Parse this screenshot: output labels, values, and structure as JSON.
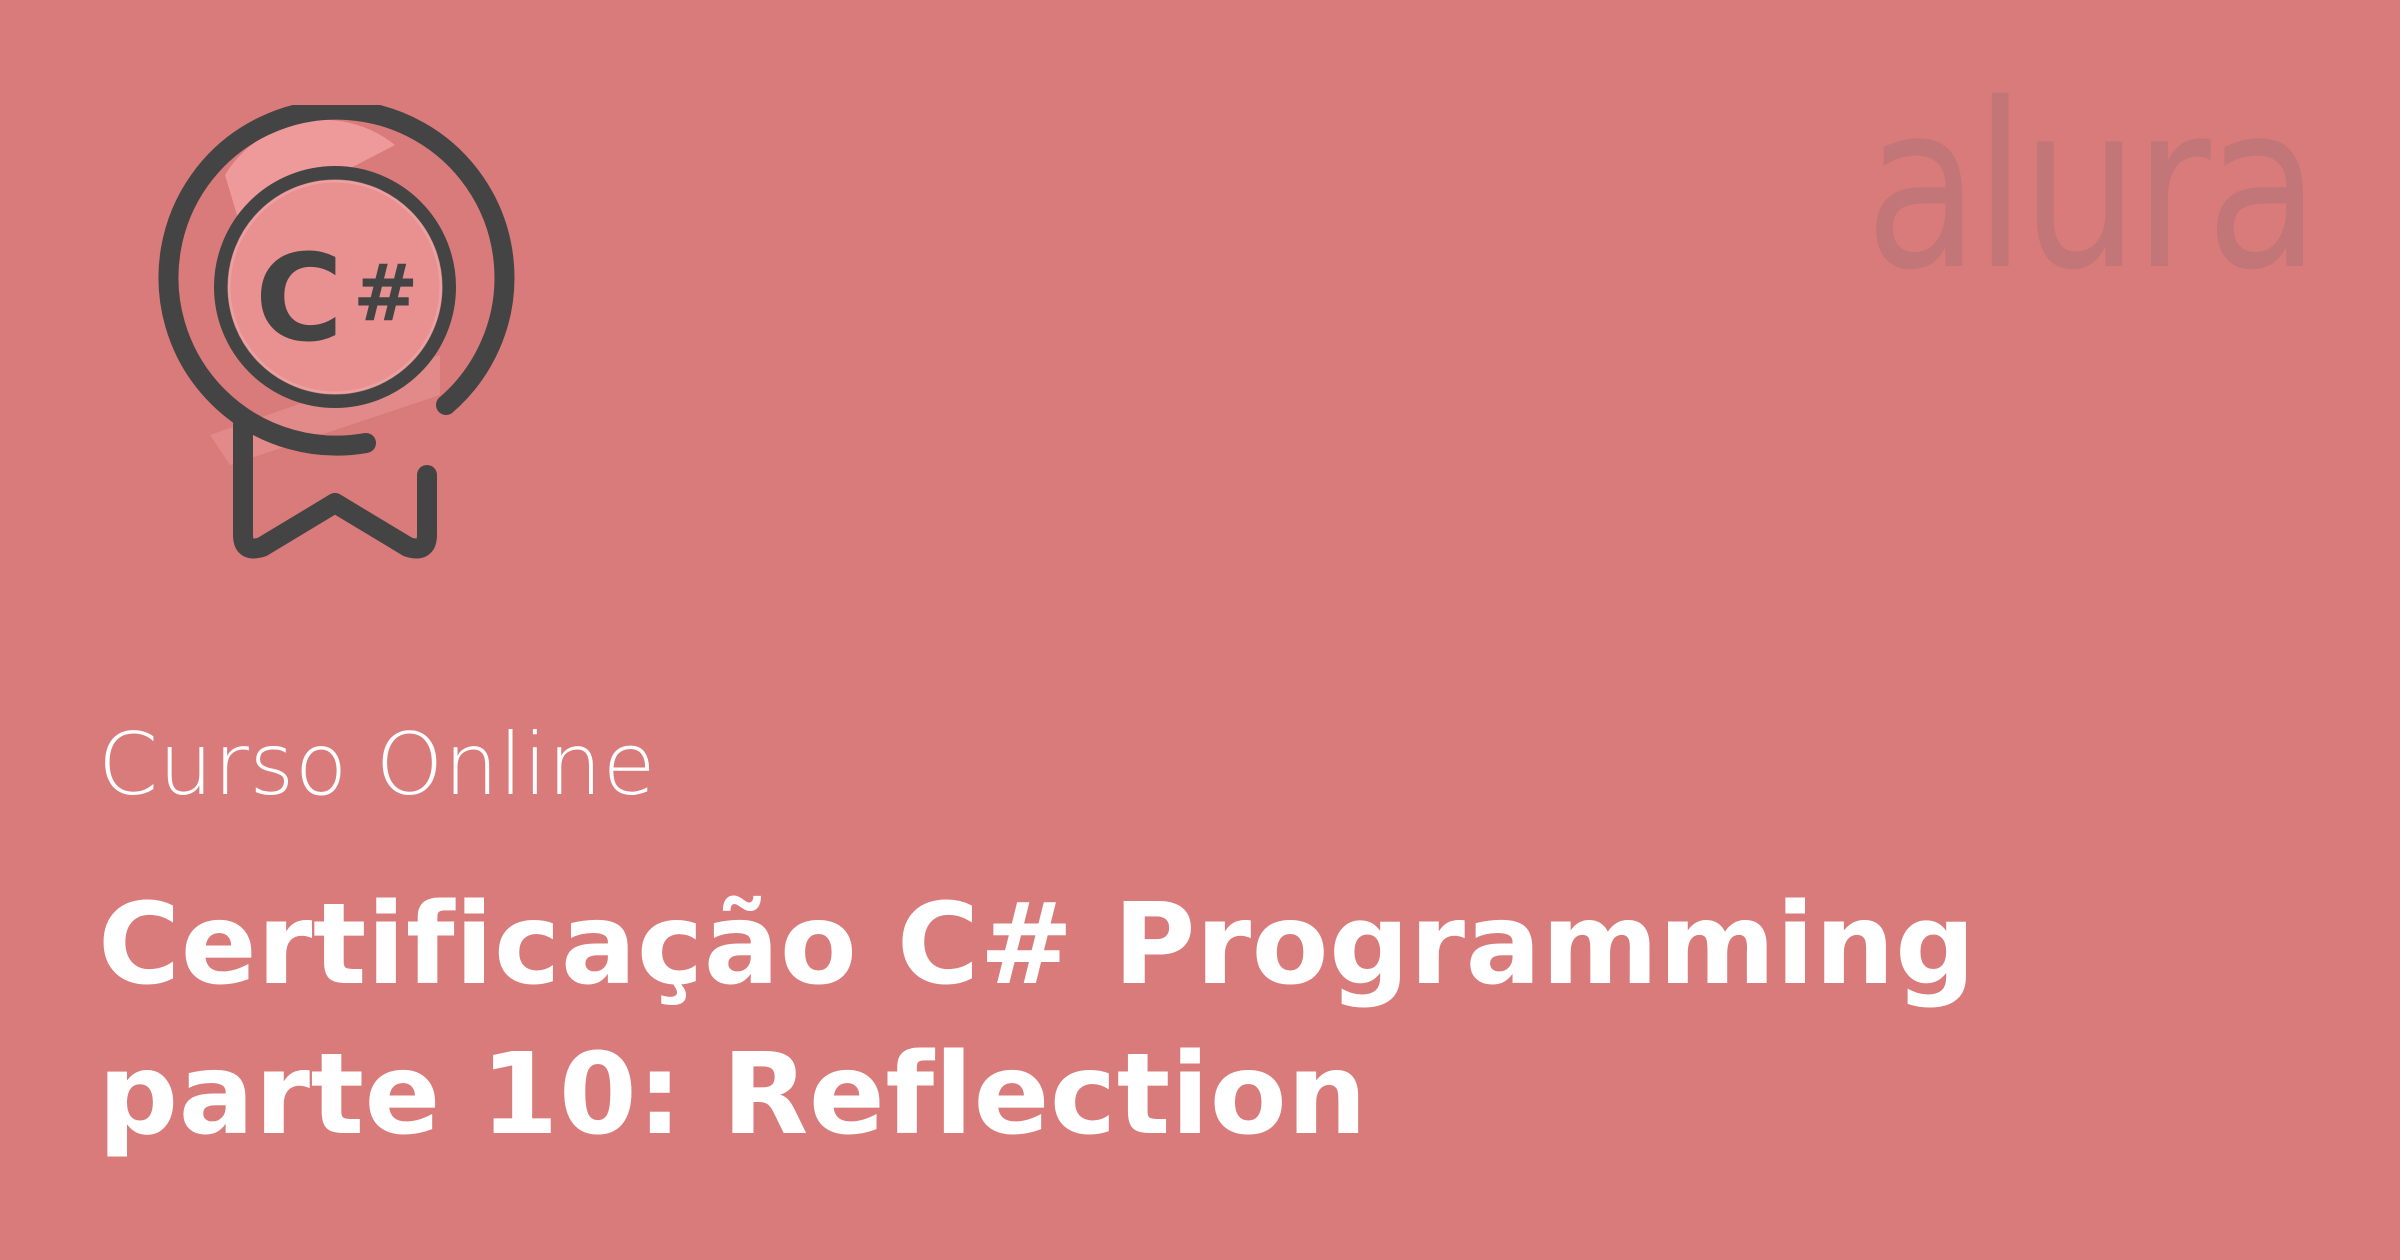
{
  "course": {
    "kicker": "Curso Online",
    "title": "Certificação C# Programming parte 10: Reflection"
  },
  "badge": {
    "icon": "csharp-certificate-badge-icon",
    "glyph_main": "C",
    "glyph_sharp": "#"
  },
  "brand": {
    "name": "alura",
    "logo_icon": "alura-wordmark-logo"
  },
  "colors": {
    "background": "#d97b7a",
    "badge_stroke": "#444444",
    "badge_highlight": "#f2a0a0",
    "logo": "#c37677",
    "text": "#ffffff"
  }
}
